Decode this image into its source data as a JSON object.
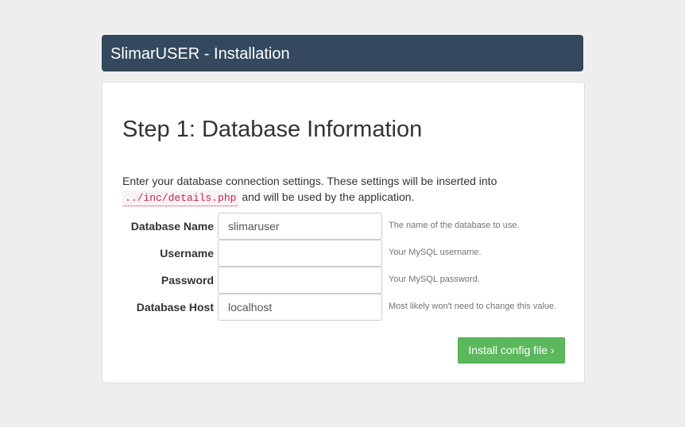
{
  "header": {
    "title": "SlimarUSER - Installation"
  },
  "main": {
    "step_title": "Step 1: Database Information",
    "intro_text_1": "Enter your database connection settings. These settings will be inserted into",
    "intro_code": "../inc/details.php",
    "intro_text_2": "and will be used by the application."
  },
  "form": {
    "fields": [
      {
        "label": "Database Name",
        "value": "slimaruser",
        "help": "The name of the database to use."
      },
      {
        "label": "Username",
        "value": "",
        "help": "Your MySQL username."
      },
      {
        "label": "Password",
        "value": "",
        "help": "Your MySQL password."
      },
      {
        "label": "Database Host",
        "value": "localhost",
        "help": "Most likely won't need to change this value."
      }
    ],
    "submit_label": "Install config file ›"
  },
  "colors": {
    "header_bg": "#34495e",
    "button_bg": "#5cb85c",
    "code_text": "#c7254e"
  }
}
